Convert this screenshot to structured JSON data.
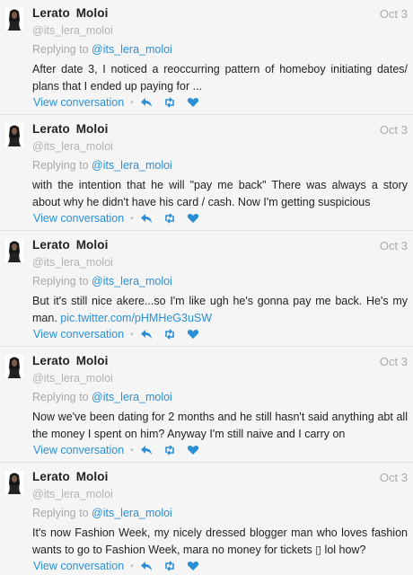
{
  "tweets": [
    {
      "name": "Lerato  Moloi",
      "handle": "@its_lera_moloi",
      "time": "Oct 3",
      "reply_prefix": "Replying to",
      "reply_to": "@its_lera_moloi",
      "text": "After date 3, I noticed a reoccurring pattern of homeboy initiating dates/ plans that I ended up paying for ...",
      "link": "",
      "view_label": "View conversation"
    },
    {
      "name": "Lerato  Moloi",
      "handle": "@its_lera_moloi",
      "time": "Oct 3",
      "reply_prefix": "Replying to",
      "reply_to": "@its_lera_moloi",
      "text": "with the intention that he will \"pay me back\" There was always a story about why he didn't have his card / cash. Now I'm getting suspicious",
      "link": "",
      "view_label": "View conversation"
    },
    {
      "name": "Lerato  Moloi",
      "handle": "@its_lera_moloi",
      "time": "Oct 3",
      "reply_prefix": "Replying to",
      "reply_to": "@its_lera_moloi",
      "text": "But it's still nice akere...so I'm like ugh he's gonna pay me back. He's my man. ",
      "link": "pic.twitter.com/pHMHeG3uSW",
      "view_label": "View conversation"
    },
    {
      "name": "Lerato  Moloi",
      "handle": "@its_lera_moloi",
      "time": "Oct 3",
      "reply_prefix": "Replying to",
      "reply_to": "@its_lera_moloi",
      "text": "Now we've been dating for 2 months and he still hasn't said anything abt all the money I spent on him? Anyway I'm still naive and I carry on",
      "link": "",
      "view_label": "View conversation"
    },
    {
      "name": "Lerato  Moloi",
      "handle": "@its_lera_moloi",
      "time": "Oct 3",
      "reply_prefix": "Replying to",
      "reply_to": "@its_lera_moloi",
      "text": "It's now Fashion Week, my nicely dressed blogger man who loves fashion wants to go to Fashion Week, mara no money for tickets ▯ lol  how?",
      "link": "",
      "view_label": "View conversation"
    }
  ],
  "icons": {
    "reply": "reply-icon",
    "retweet": "retweet-icon",
    "like": "heart-icon"
  },
  "colors": {
    "link": "#2b8fd6",
    "muted": "#aaaaaa",
    "background": "#f5f5f5"
  }
}
